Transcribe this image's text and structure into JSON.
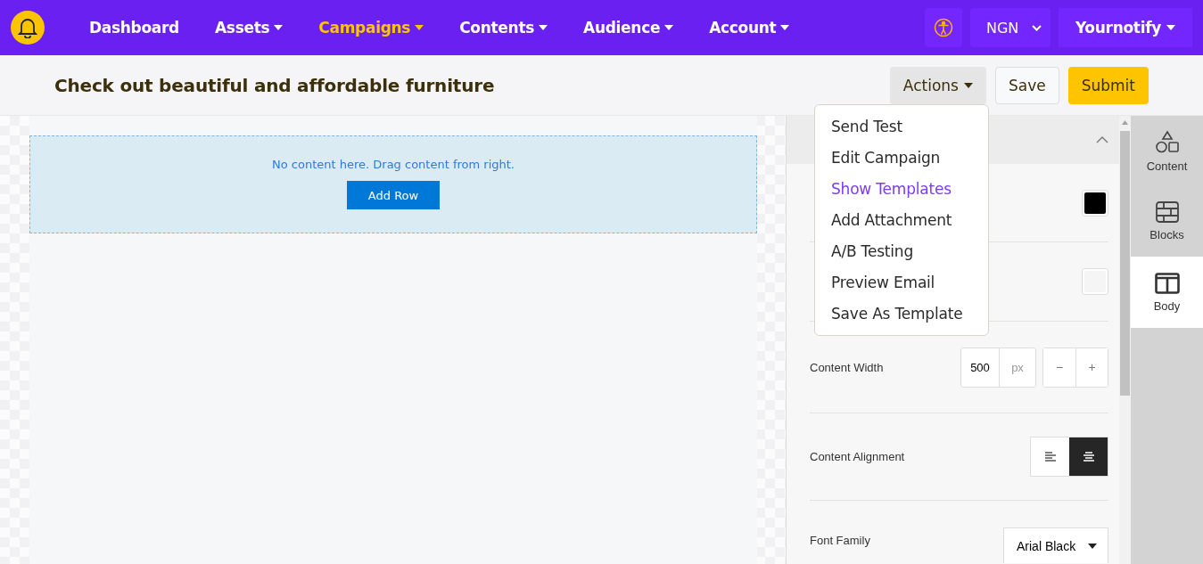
{
  "nav": {
    "items": [
      {
        "label": "Dashboard",
        "dropdown": false,
        "selected": false
      },
      {
        "label": "Assets",
        "dropdown": true,
        "selected": false
      },
      {
        "label": "Campaigns",
        "dropdown": true,
        "selected": true
      },
      {
        "label": "Contents",
        "dropdown": true,
        "selected": false
      },
      {
        "label": "Audience",
        "dropdown": true,
        "selected": false
      },
      {
        "label": "Account",
        "dropdown": true,
        "selected": false
      }
    ],
    "currency": "NGN",
    "account": "Yournotify"
  },
  "header": {
    "title": "Check out beautiful and affordable furniture",
    "actions": "Actions",
    "save": "Save",
    "submit": "Submit"
  },
  "actions_menu": [
    {
      "label": "Send Test",
      "selected": false
    },
    {
      "label": "Edit Campaign",
      "selected": false
    },
    {
      "label": "Show Templates",
      "selected": true
    },
    {
      "label": "Add Attachment",
      "selected": false
    },
    {
      "label": "A/B Testing",
      "selected": false
    },
    {
      "label": "Preview Email",
      "selected": false
    },
    {
      "label": "Save As Template",
      "selected": false
    }
  ],
  "canvas": {
    "message": "No content here. Drag content from right.",
    "button": "Add Row"
  },
  "settings": {
    "expanded": true,
    "rows": [
      {
        "kind": "color",
        "color": "#000000"
      },
      {
        "kind": "color",
        "color": "#f5f5f5"
      },
      {
        "kind": "number",
        "label": "Content Width",
        "value": "500",
        "unit": "px",
        "stepper": [
          "−",
          "+"
        ]
      },
      {
        "kind": "align",
        "label": "Content Alignment",
        "options": [
          {
            "kind": "left",
            "selected": false
          },
          {
            "kind": "center",
            "selected": true
          }
        ]
      },
      {
        "kind": "select",
        "label": "Font Family",
        "value": "Arial Black"
      }
    ]
  },
  "side_tabs": [
    {
      "kind": "shapes",
      "label": "Content",
      "selected": false
    },
    {
      "kind": "bricks",
      "label": "Blocks",
      "selected": false
    },
    {
      "kind": "columns",
      "label": "Body",
      "selected": true
    }
  ]
}
